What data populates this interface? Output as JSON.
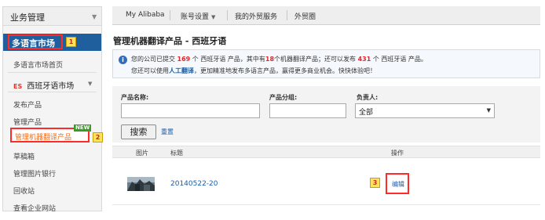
{
  "sidebar": {
    "title": "业务管理",
    "multilang_market": "多语言市场",
    "step1": "1",
    "multilang_home": "多语言市场首页",
    "es_badge": "ES",
    "spanish_market": "西班牙语市场",
    "items": {
      "publish": "发布产品",
      "manage": "管理产品",
      "machine_translate": "管理机器翻译产品",
      "draft": "草稿箱",
      "images": "管理图片银行",
      "recycle": "回收站",
      "view_site": "查看企业网站"
    },
    "new_badge": "NEW",
    "step2": "2"
  },
  "topnav": {
    "my_alibaba": "My Alibaba",
    "account": "账号设置",
    "trade_service": "我的外贸服务",
    "trade_circle": "外贸圈"
  },
  "page": {
    "title": "管理机器翻译产品 - 西班牙语"
  },
  "notice": {
    "l1_a": "您的公司已提交 ",
    "submitted": "169",
    "l1_b": " 个 西班牙语 产品，其中有",
    "machine_count": "18",
    "l1_c": "个机器翻译产品；还可以发布 ",
    "remaining": "431",
    "l1_d": " 个 西班牙语 产品。",
    "l2_a": "您还可以使用",
    "human_translation": "人工翻译",
    "l2_b": "，更加精准地发布多语言产品，赢得更多商业机会。快快体验吧！"
  },
  "filters": {
    "name_label": "产品名称:",
    "group_label": "产品分组:",
    "owner_label": "负责人:",
    "owner_value": "全部",
    "search_button": "搜索",
    "reset_link": "重置"
  },
  "table": {
    "headers": {
      "image": "图片",
      "title": "标题",
      "operation": "操作"
    },
    "rows": [
      {
        "title": "20140522-20",
        "action": "编辑"
      }
    ]
  },
  "step3": "3",
  "colors": {
    "sidebar_active_bg": "#1f5f9e",
    "highlight_red": "#ff2a2a",
    "link_blue": "#1a5ea8",
    "orange_active": "#ff6600",
    "new_green": "#3c9a2a"
  }
}
